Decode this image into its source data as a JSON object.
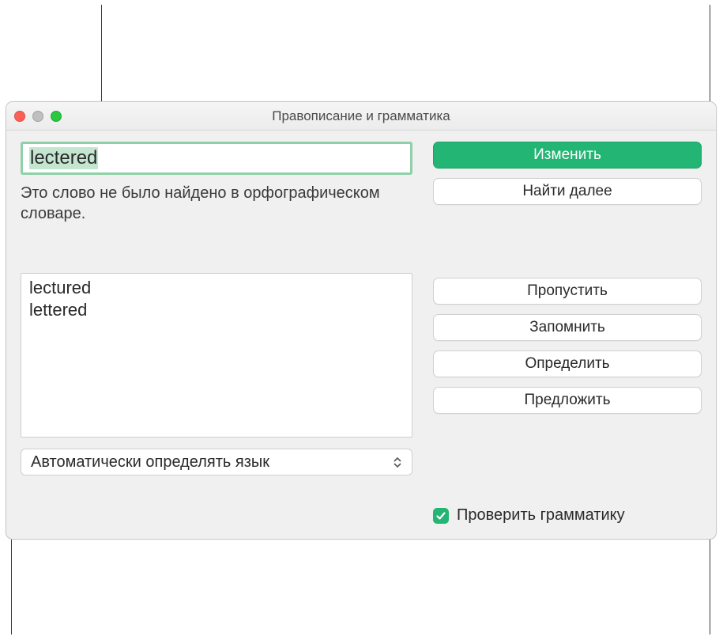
{
  "window": {
    "title": "Правописание и грамматика"
  },
  "traffic": {
    "close_color": "#ff5f57",
    "min_color": "#bfbfbf",
    "max_color": "#28c840"
  },
  "word_field": {
    "value": "lectered"
  },
  "status_text": "Это слово не было найдено в орфографическом словаре.",
  "suggestions": [
    "lectured",
    "lettered"
  ],
  "language_select": {
    "selected": "Автоматически определять язык"
  },
  "buttons": {
    "change": "Изменить",
    "find_next": "Найти далее",
    "ignore": "Пропустить",
    "learn": "Запомнить",
    "define": "Определить",
    "guess": "Предложить"
  },
  "checkbox": {
    "label": "Проверить грамматику",
    "checked": true
  }
}
